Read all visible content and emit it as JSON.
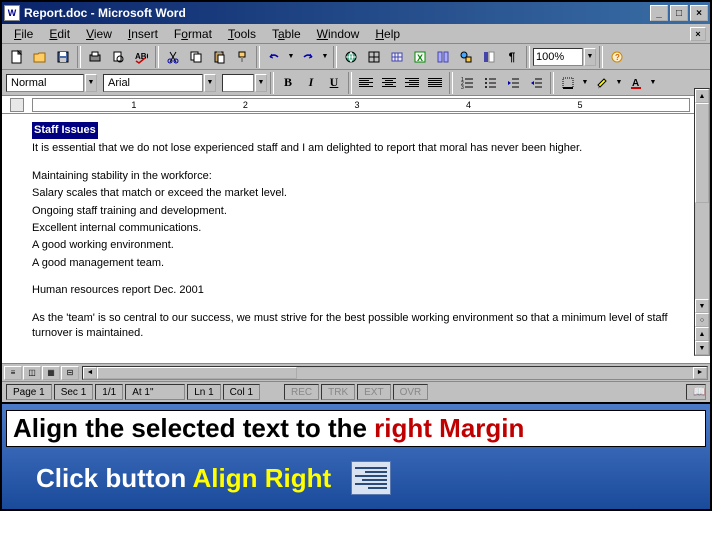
{
  "titlebar": {
    "icon": "W",
    "title": "Report.doc - Microsoft Word"
  },
  "menus": {
    "file": "File",
    "edit": "Edit",
    "view": "View",
    "insert": "Insert",
    "format": "Format",
    "tools": "Tools",
    "table": "Table",
    "window": "Window",
    "help": "Help"
  },
  "toolbar": {
    "zoom": "100%"
  },
  "format_bar": {
    "style": "Normal",
    "font": "Arial",
    "size": "",
    "bold": "B",
    "italic": "I",
    "underline": "U"
  },
  "ruler": {
    "n1": "1",
    "n2": "2",
    "n3": "3",
    "n4": "4",
    "n5": "5"
  },
  "document": {
    "heading": "Staff Issues",
    "p1": "It is essential that we do not lose experienced staff and I am delighted to report that moral has never been higher.",
    "p2": "Maintaining stability in the workforce:",
    "p3": "Salary scales that match or exceed the market level.",
    "p4": "Ongoing staff training and development.",
    "p5": "Excellent internal communications.",
    "p6": "A good working environment.",
    "p7": "A good management team.",
    "p8": "Human resources report Dec. 2001",
    "p9": "As the 'team' is so central to our success, we must strive for the best possible working environment so that a minimum level of staff turnover is maintained."
  },
  "statusbar": {
    "page": "Page 1",
    "sec": "Sec 1",
    "pages": "1/1",
    "at": "At 1\"",
    "ln": "Ln 1",
    "col": "Col 1",
    "rec": "REC",
    "trk": "TRK",
    "ext": "EXT",
    "ovr": "OVR"
  },
  "instruction": {
    "title_black": "Align the selected text to the ",
    "title_red": "right Margin",
    "sub_white": "Click button ",
    "sub_yellow": "Align Right"
  }
}
